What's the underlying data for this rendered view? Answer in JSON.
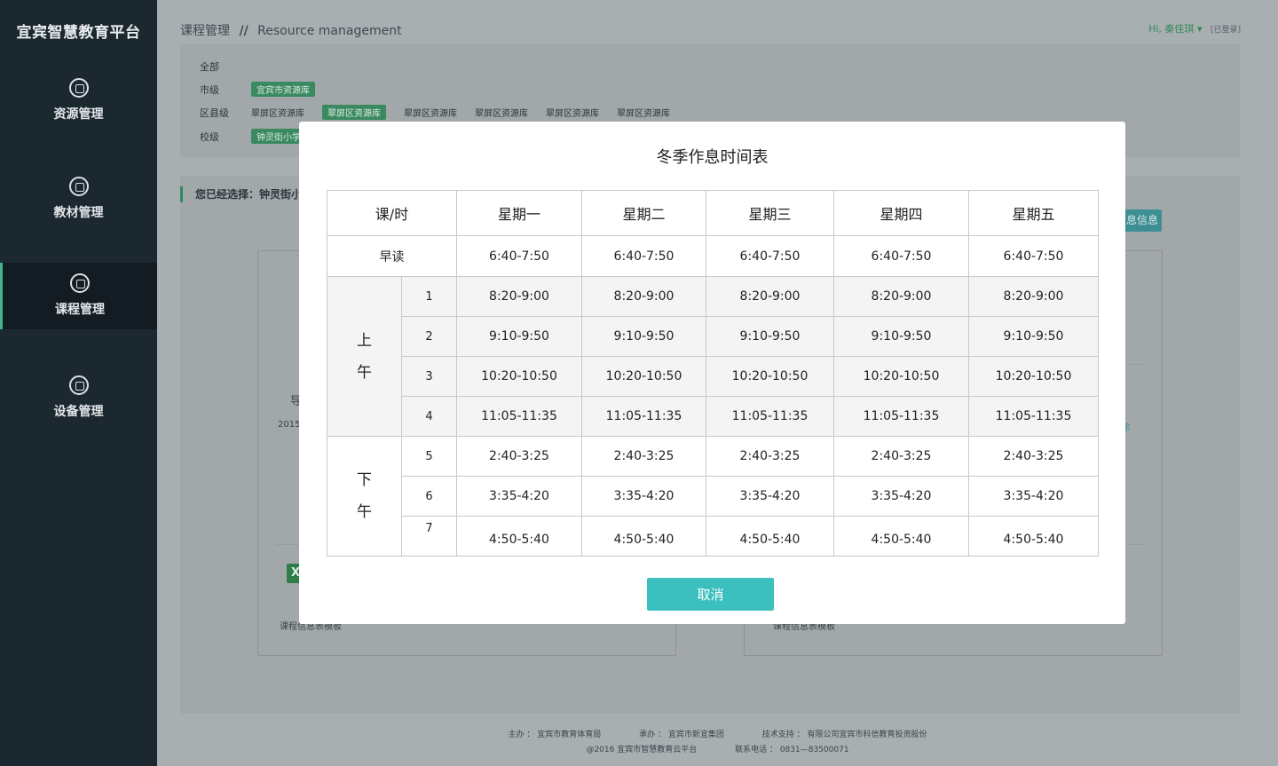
{
  "app": {
    "logo": "宜宾智慧教育平台"
  },
  "sidebar": {
    "items": [
      {
        "label": "资源管理",
        "icon": "resource-icon"
      },
      {
        "label": "教材管理",
        "icon": "book-icon"
      },
      {
        "label": "课程管理",
        "icon": "layers-icon",
        "active": true
      },
      {
        "label": "设备管理",
        "icon": "wrench-icon"
      }
    ]
  },
  "header": {
    "breadcrumb_cn": "课程管理",
    "breadcrumb_sep": "//",
    "breadcrumb_en": "Resource management",
    "user_greeting": "Hi, 秦佳琪",
    "logged_in": "[已登录]"
  },
  "filters": {
    "all_label": "全部",
    "city_label": "市级",
    "city_options": [
      "宜宾市资源库"
    ],
    "county_label": "区县级",
    "county_options": [
      "翠屏区资源库",
      "翠屏区资源库",
      "翠屏区资源库",
      "翠屏区资源库",
      "翠屏区资源库",
      "翠屏区资源库"
    ],
    "school_label": "校级",
    "school_options": [
      "钟灵街小学"
    ]
  },
  "content": {
    "selected_text": "您已经选择：钟灵街小",
    "info_button": "息信息",
    "left_card_partial_label": "导",
    "left_card_partial_year": "2015",
    "left_card_file": "课程信息表模板",
    "right_card_file": "课程信息表模板",
    "right_card_partial": "除"
  },
  "footer": {
    "host": "主办 ： 宜宾市教育体育局",
    "organizer": "承办 ： 宜宾市新宜集团",
    "tech": "技术支持 ： 有限公司宜宾市科信教育投资股份",
    "copyright": "@2016   宜宾市智慧教育云平台",
    "phone": "联系电话 ： 0831—83500071"
  },
  "modal": {
    "title": "冬季作息时间表",
    "header": [
      "课/时",
      "星期一",
      "星期二",
      "星期三",
      "星期四",
      "星期五"
    ],
    "morning_read": {
      "label": "早读",
      "times": [
        "6:40-7:50",
        "6:40-7:50",
        "6:40-7:50",
        "6:40-7:50",
        "6:40-7:50"
      ]
    },
    "am_label_1": "上",
    "am_label_2": "午",
    "pm_label_1": "下",
    "pm_label_2": "午",
    "rows": [
      {
        "n": "1",
        "times": [
          "8:20-9:00",
          "8:20-9:00",
          "8:20-9:00",
          "8:20-9:00",
          "8:20-9:00"
        ]
      },
      {
        "n": "2",
        "times": [
          "9:10-9:50",
          "9:10-9:50",
          "9:10-9:50",
          "9:10-9:50",
          "9:10-9:50"
        ]
      },
      {
        "n": "3",
        "times": [
          "10:20-10:50",
          "10:20-10:50",
          "10:20-10:50",
          "10:20-10:50",
          "10:20-10:50"
        ]
      },
      {
        "n": "4",
        "times": [
          "11:05-11:35",
          "11:05-11:35",
          "11:05-11:35",
          "11:05-11:35",
          "11:05-11:35"
        ]
      },
      {
        "n": "5",
        "times": [
          "2:40-3:25",
          "2:40-3:25",
          "2:40-3:25",
          "2:40-3:25",
          "2:40-3:25"
        ]
      },
      {
        "n": "6",
        "times": [
          "3:35-4:20",
          "3:35-4:20",
          "3:35-4:20",
          "3:35-4:20",
          "3:35-4:20"
        ]
      },
      {
        "n": "7",
        "times": [
          "4:50-5:40",
          "4:50-5:40",
          "4:50-5:40",
          "4:50-5:40",
          "4:50-5:40"
        ]
      }
    ],
    "cancel_label": "取消"
  },
  "colors": {
    "sidebar_bg": "#1c2830",
    "accent_green": "#3fb68a",
    "cancel_button": "#3cbfbf"
  }
}
